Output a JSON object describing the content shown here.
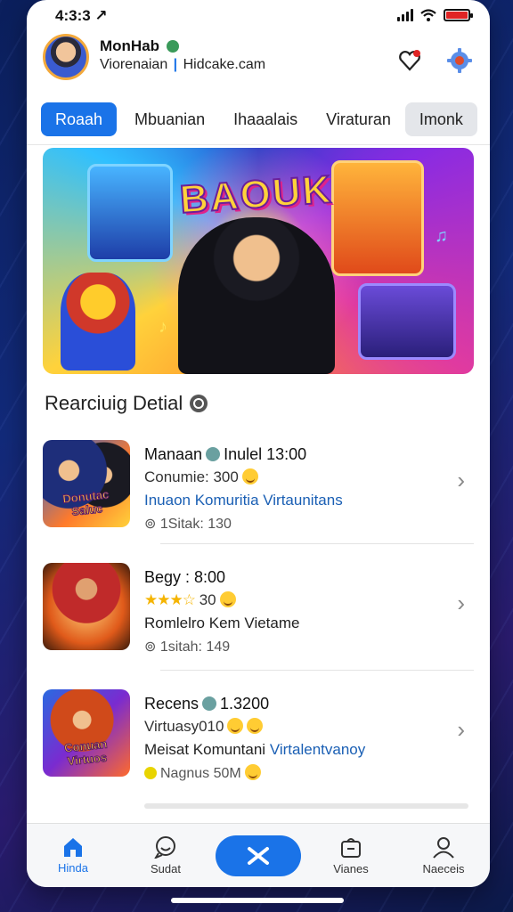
{
  "status": {
    "time": "4:3:3 ↗"
  },
  "header": {
    "user_name": "MonHab",
    "sub_left": "Viorenaian",
    "sub_sep": "|",
    "sub_right": "Hidcake.cam"
  },
  "tabs": [
    {
      "label": "Roaah",
      "active": true
    },
    {
      "label": "Mbuanian",
      "active": false
    },
    {
      "label": "Ihaaalais",
      "active": false
    },
    {
      "label": "Viraturan",
      "active": false
    },
    {
      "label": "Imonk",
      "active": false
    }
  ],
  "banner": {
    "title": "BAOUK"
  },
  "section": {
    "title": "Rearciuig Detial"
  },
  "items": [
    {
      "title": "Manaan",
      "title_rest": "Inulel 13:00",
      "line2": "Conumie: 300",
      "line3": "Inuaon Komuritia Virtaunitans",
      "line4": "⊚ 1Sitak: 130",
      "thumb_label": "Donutac Saluc"
    },
    {
      "title": "Begy : 8:00",
      "rating": "★★★☆",
      "line2": "30",
      "line3": "Romlelro Kem Vietame",
      "line4": "⊚ 1sitah: 149",
      "thumb_label": ""
    },
    {
      "title": "Recens",
      "title_rest": "1.3200",
      "line2": "Virtuasy010",
      "line3_a": "Meisat Komuntani",
      "line3_b": "Virtalentvanoy",
      "line4": "Nagnus 50M",
      "thumb_label": "Conuan Virtuos"
    }
  ],
  "bottom_nav": [
    {
      "label": "Hinda",
      "icon": "home-icon",
      "active": true
    },
    {
      "label": "Sudat",
      "icon": "chat-smile-icon",
      "active": false
    },
    {
      "label": "",
      "icon": "x-logo-icon",
      "active": false
    },
    {
      "label": "Vianes",
      "icon": "bag-icon",
      "active": false
    },
    {
      "label": "Naeceis",
      "icon": "profile-icon",
      "active": false
    }
  ],
  "colors": {
    "accent": "#1a73e8",
    "battery": "#e02424",
    "star": "#f5b400"
  }
}
